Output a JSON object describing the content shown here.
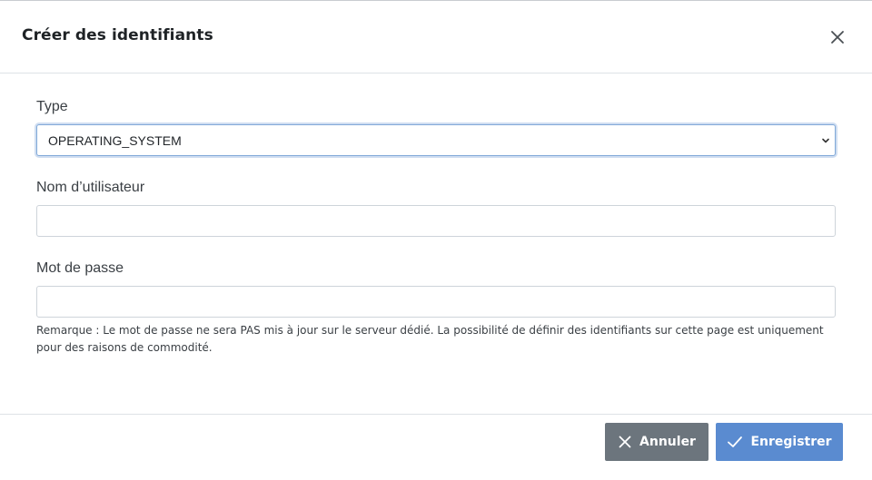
{
  "dialog": {
    "title": "Créer des identifiants"
  },
  "form": {
    "type_label": "Type",
    "type_value": "OPERATING_SYSTEM",
    "username_label": "Nom d’utilisateur",
    "username_value": "",
    "password_label": "Mot de passe",
    "password_value": "",
    "remark": "Remarque : Le mot de passe ne sera PAS mis à jour sur le serveur dédié. La possibilité de définir des identifiants sur cette page est uniquement pour des raisons de commodité."
  },
  "footer": {
    "cancel_label": "Annuler",
    "save_label": "Enregistrer"
  },
  "colors": {
    "cancel_button": "#6c757d",
    "save_button": "#5a8bd0",
    "focus_border": "#80a8d8"
  },
  "icons": {
    "close": "close-icon",
    "select_chevron": "chevron-down-icon",
    "cancel": "x-icon",
    "save": "check-icon"
  }
}
